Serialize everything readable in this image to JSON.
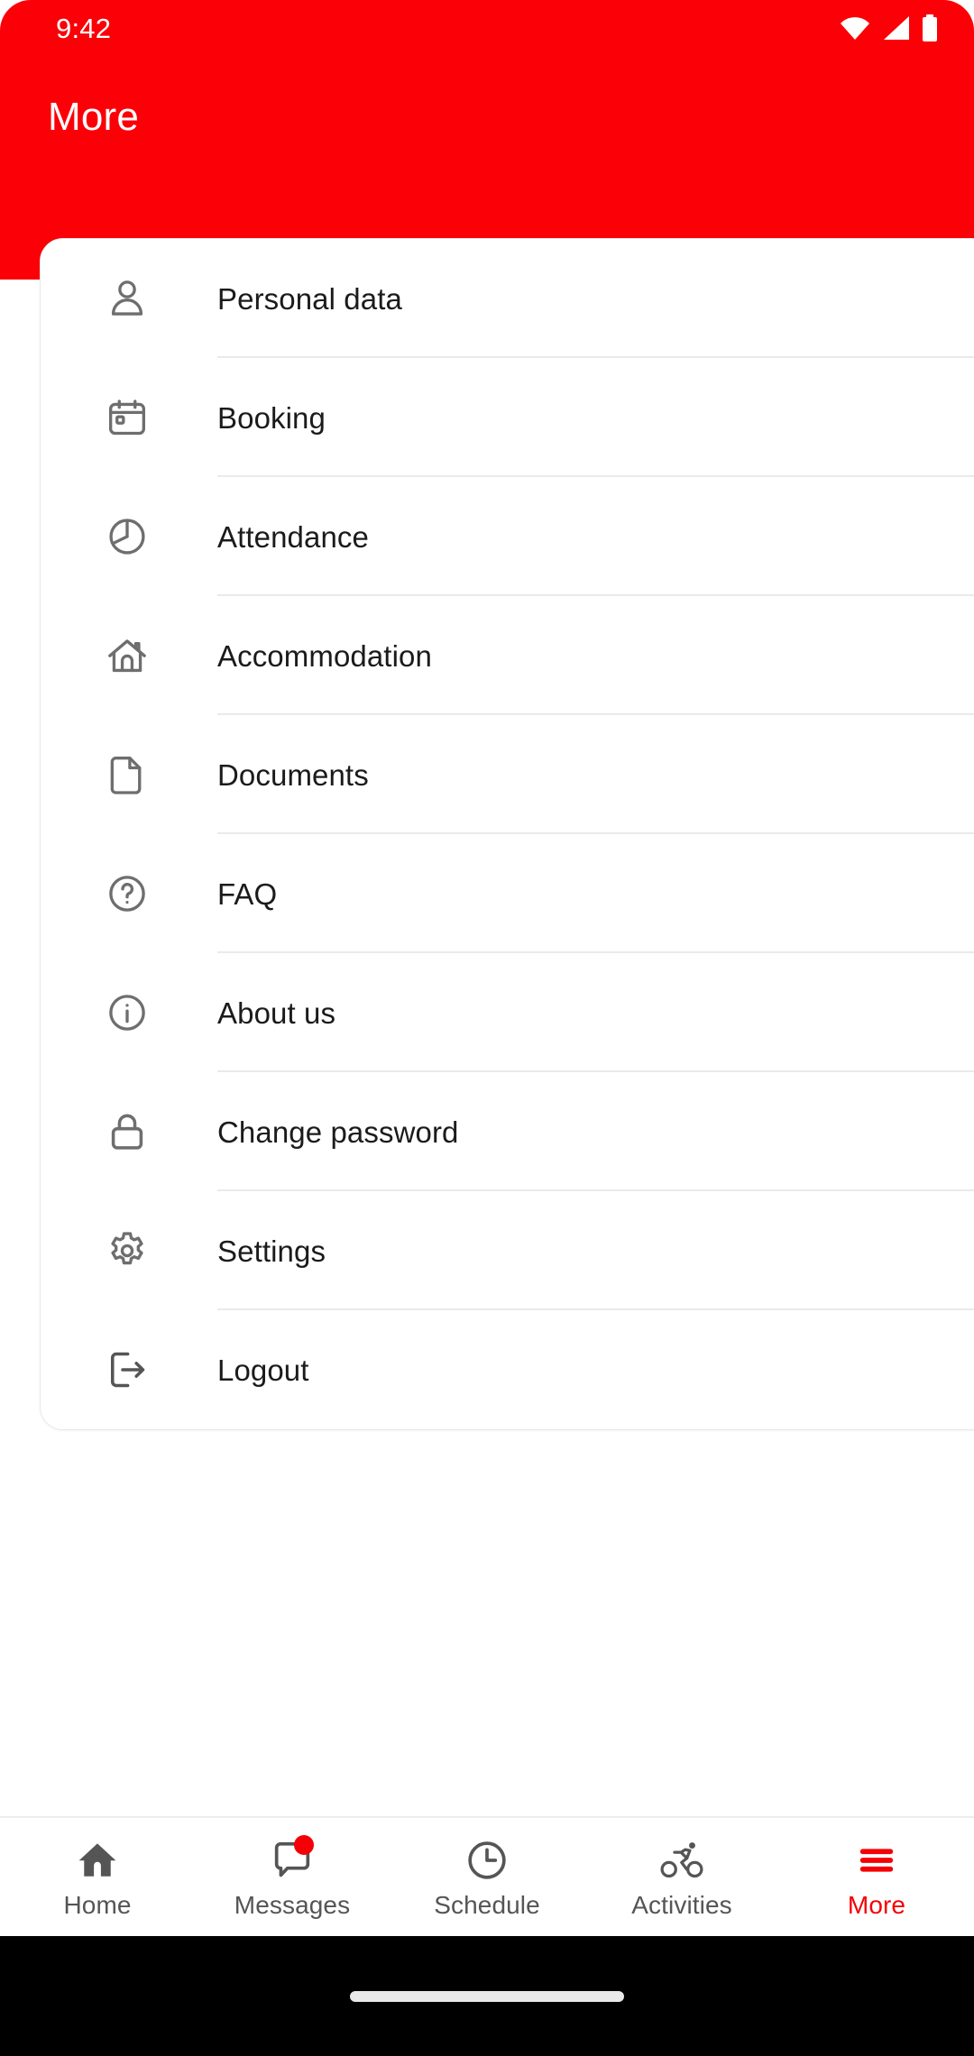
{
  "statusbar": {
    "time": "9:42",
    "icons": [
      "wifi-icon",
      "cellular-signal-icon",
      "battery-icon"
    ]
  },
  "header": {
    "title": "More",
    "background_color": "#fb0007"
  },
  "menu": {
    "items": [
      {
        "label": "Personal data",
        "icon": "person-icon"
      },
      {
        "label": "Booking",
        "icon": "calendar-event-icon"
      },
      {
        "label": "Attendance",
        "icon": "pie-chart-icon"
      },
      {
        "label": "Accommodation",
        "icon": "home-icon"
      },
      {
        "label": "Documents",
        "icon": "document-icon"
      },
      {
        "label": "FAQ",
        "icon": "question-circle-icon"
      },
      {
        "label": "About us",
        "icon": "info-circle-icon"
      },
      {
        "label": "Change password",
        "icon": "lock-icon"
      },
      {
        "label": "Settings",
        "icon": "gear-icon"
      },
      {
        "label": "Logout",
        "icon": "logout-icon"
      }
    ]
  },
  "bottom_nav": {
    "active": "More",
    "accent_color": "#f50005",
    "inactive_color": "#555555",
    "items": [
      {
        "label": "Home",
        "icon": "home-filled-icon",
        "badge": false,
        "active": false
      },
      {
        "label": "Messages",
        "icon": "chat-bubble-icon",
        "badge": true,
        "active": false
      },
      {
        "label": "Schedule",
        "icon": "clock-icon",
        "badge": false,
        "active": false
      },
      {
        "label": "Activities",
        "icon": "cyclist-icon",
        "badge": false,
        "active": false
      },
      {
        "label": "More",
        "icon": "hamburger-menu-icon",
        "badge": false,
        "active": true
      }
    ]
  }
}
